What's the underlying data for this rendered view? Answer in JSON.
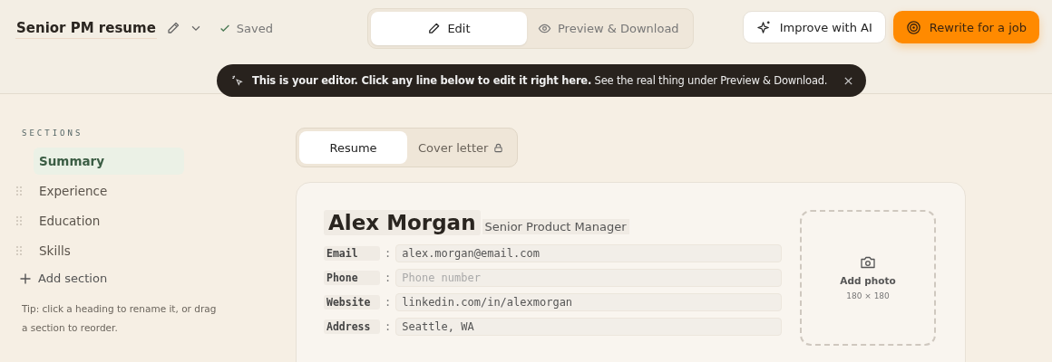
{
  "document": {
    "title": "Senior PM resume",
    "status": "Saved"
  },
  "mode_tabs": [
    {
      "label": "Edit",
      "selected": true
    },
    {
      "label": "Preview & Download",
      "selected": false
    }
  ],
  "actions": [
    {
      "label": "Improve with AI",
      "kind": "secondary"
    },
    {
      "label": "Rewrite for a job",
      "kind": "primary"
    }
  ],
  "toast": {
    "text": "**This is your editor. Click any line below to edit it right here.** See the real thing under Preview & Download."
  },
  "sidebar": {
    "heading": "SECTIONS",
    "items": [
      {
        "label": "Summary",
        "selected": true
      },
      {
        "label": "Experience",
        "selected": false
      },
      {
        "label": "Education",
        "selected": false
      },
      {
        "label": "Skills",
        "selected": false
      }
    ],
    "add_label": "Add section",
    "tip": "Tip: click a heading to rename it, or drag a section to reorder."
  },
  "doc_tabs": [
    {
      "label": "Resume",
      "selected": true,
      "locked": false
    },
    {
      "label": "Cover letter",
      "selected": false,
      "locked": true
    }
  ],
  "resume": {
    "name": "Alex Morgan",
    "headline": "Senior Product Manager",
    "fields": [
      {
        "label": "Email",
        "separator": ":",
        "value": "alex.morgan@email.com"
      },
      {
        "label": "Phone",
        "separator": ":",
        "placeholder": "Phone number"
      },
      {
        "label": "Website",
        "separator": ":",
        "value": "linkedin.com/in/alexmorgan"
      },
      {
        "label": "Address",
        "separator": ":",
        "value": "Seattle, WA"
      }
    ],
    "photo": {
      "label": "Add photo",
      "size": "180 × 180"
    }
  }
}
